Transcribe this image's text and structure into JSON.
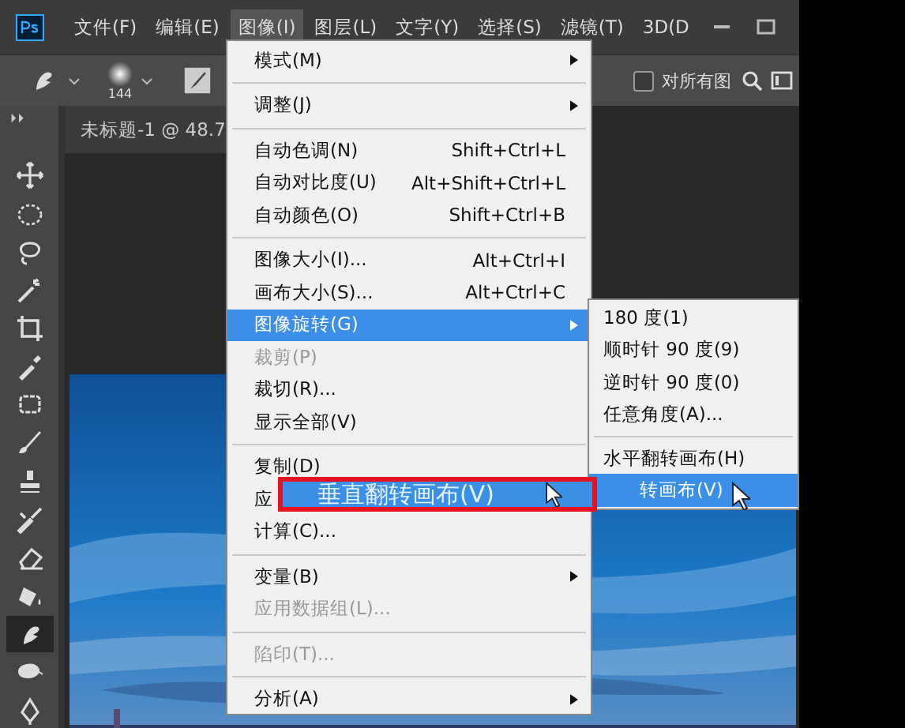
{
  "menubar": [
    {
      "label": "文件(F)",
      "selected": false
    },
    {
      "label": "编辑(E)",
      "selected": false
    },
    {
      "label": "图像(I)",
      "selected": true
    },
    {
      "label": "图层(L)",
      "selected": false
    },
    {
      "label": "文字(Y)",
      "selected": false
    },
    {
      "label": "选择(S)",
      "selected": false
    },
    {
      "label": "滤镜(T)",
      "selected": false
    },
    {
      "label": "3D(D",
      "selected": false
    }
  ],
  "options_bar": {
    "brush_size": "144",
    "checkbox": {
      "label": "对所有图",
      "checked": false
    }
  },
  "document_tab": {
    "title": "未标题-1 @ 48.7"
  },
  "tools": [
    {
      "selected": false
    },
    {
      "selected": false
    },
    {
      "selected": false
    },
    {
      "selected": false
    },
    {
      "selected": false
    },
    {
      "selected": false
    },
    {
      "selected": false
    },
    {
      "selected": false
    },
    {
      "selected": false
    },
    {
      "selected": false
    },
    {
      "selected": false
    },
    {
      "selected": false
    },
    {
      "selected": true
    },
    {
      "selected": false
    },
    {
      "selected": false
    }
  ],
  "image_menu": [
    {
      "kind": "item",
      "label": "模式(M)",
      "submenu": true,
      "disabled": false,
      "selected": false
    },
    {
      "kind": "separator"
    },
    {
      "kind": "item",
      "label": "调整(J)",
      "submenu": true,
      "disabled": false,
      "selected": false
    },
    {
      "kind": "separator"
    },
    {
      "kind": "item",
      "label": "自动色调(N)",
      "shortcut": "Shift+Ctrl+L",
      "submenu": false,
      "disabled": false,
      "selected": false
    },
    {
      "kind": "item",
      "label": "自动对比度(U)",
      "shortcut": "Alt+Shift+Ctrl+L",
      "submenu": false,
      "disabled": false,
      "selected": false
    },
    {
      "kind": "item",
      "label": "自动颜色(O)",
      "shortcut": "Shift+Ctrl+B",
      "submenu": false,
      "disabled": false,
      "selected": false
    },
    {
      "kind": "separator"
    },
    {
      "kind": "item",
      "label": "图像大小(I)...",
      "shortcut": "Alt+Ctrl+I",
      "submenu": false,
      "disabled": false,
      "selected": false
    },
    {
      "kind": "item",
      "label": "画布大小(S)...",
      "shortcut": "Alt+Ctrl+C",
      "submenu": false,
      "disabled": false,
      "selected": false
    },
    {
      "kind": "item",
      "label": "图像旋转(G)",
      "submenu": true,
      "disabled": false,
      "selected": true
    },
    {
      "kind": "item",
      "label": "裁剪(P)",
      "submenu": false,
      "disabled": true,
      "selected": false
    },
    {
      "kind": "item",
      "label": "裁切(R)...",
      "submenu": false,
      "disabled": false,
      "selected": false
    },
    {
      "kind": "item",
      "label": "显示全部(V)",
      "submenu": false,
      "disabled": false,
      "selected": false
    },
    {
      "kind": "separator"
    },
    {
      "kind": "item",
      "label": "复制(D)",
      "submenu": false,
      "disabled": false,
      "selected": false
    },
    {
      "kind": "item",
      "label": "应",
      "disabled": false,
      "selected": false
    },
    {
      "kind": "item",
      "label": "计算(C)...",
      "submenu": false,
      "disabled": false,
      "selected": false
    },
    {
      "kind": "separator"
    },
    {
      "kind": "item",
      "label": "变量(B)",
      "submenu": true,
      "disabled": false,
      "selected": false
    },
    {
      "kind": "item",
      "label": "应用数据组(L)...",
      "submenu": false,
      "disabled": true,
      "selected": false
    },
    {
      "kind": "separator"
    },
    {
      "kind": "item",
      "label": "陷印(T)...",
      "submenu": false,
      "disabled": true,
      "selected": false
    },
    {
      "kind": "separator"
    },
    {
      "kind": "item",
      "label": "分析(A)",
      "submenu": true,
      "disabled": false,
      "selected": false
    }
  ],
  "rotate_submenu": [
    {
      "kind": "item",
      "label": "180 度(1)",
      "selected": false
    },
    {
      "kind": "item",
      "label": "顺时针 90 度(9)",
      "selected": false
    },
    {
      "kind": "item",
      "label": "逆时针 90 度(0)",
      "selected": false
    },
    {
      "kind": "item",
      "label": "任意角度(A)...",
      "selected": false
    },
    {
      "kind": "separator"
    },
    {
      "kind": "item",
      "label": "水平翻转画布(H)",
      "selected": false
    },
    {
      "kind": "item",
      "label": "转画布(V)",
      "selected": true
    }
  ],
  "callout": {
    "label": "垂直翻转画布(V)"
  }
}
